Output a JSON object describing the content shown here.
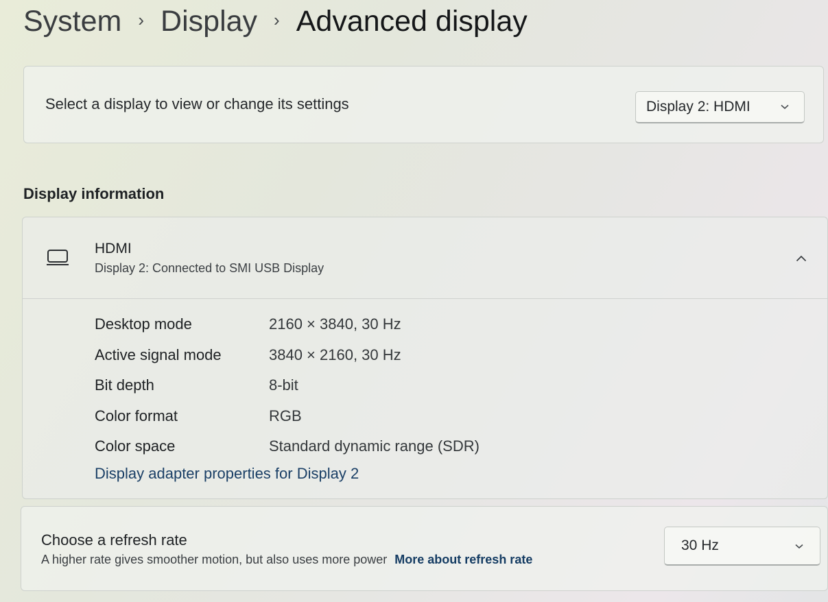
{
  "breadcrumb": {
    "items": [
      "System",
      "Display",
      "Advanced display"
    ],
    "separator": "›"
  },
  "select_display": {
    "label": "Select a display to view or change its settings",
    "dropdown_value": "Display 2: HDMI",
    "chevron_icon": "chevron-down-icon"
  },
  "display_information": {
    "title": "Display information",
    "header": {
      "icon": "monitor-icon",
      "name": "HDMI",
      "subtitle": "Display 2: Connected to SMI USB Display",
      "chevron_icon": "chevron-up-icon"
    },
    "rows": [
      {
        "key": "Desktop mode",
        "value": "2160 × 3840, 30 Hz"
      },
      {
        "key": "Active signal mode",
        "value": "3840 × 2160, 30 Hz"
      },
      {
        "key": "Bit depth",
        "value": "8-bit"
      },
      {
        "key": "Color format",
        "value": "RGB"
      },
      {
        "key": "Color space",
        "value": "Standard dynamic range (SDR)"
      }
    ],
    "adapter_link": "Display adapter properties for Display 2"
  },
  "refresh_rate": {
    "title": "Choose a refresh rate",
    "description": "A higher rate gives smoother motion, but also uses more power",
    "link": "More about refresh rate",
    "dropdown_value": "30 Hz",
    "chevron_icon": "chevron-down-icon"
  },
  "colors": {
    "link": "#1a3f66",
    "card_background": "#f0f2ee",
    "text_primary": "#1c1f22"
  }
}
